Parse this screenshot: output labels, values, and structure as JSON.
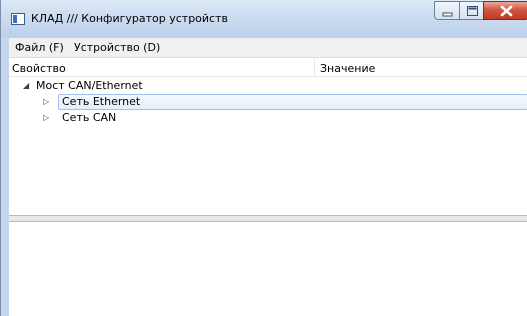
{
  "window": {
    "title": "КЛАД /// Конфигуратор устройств",
    "controls": [
      "minimize-icon",
      "maximize-icon",
      "close-icon"
    ]
  },
  "menu": {
    "items": [
      {
        "label": "Файл (F)"
      },
      {
        "label": "Устройство (D)"
      }
    ]
  },
  "table": {
    "columns": [
      "Свойство",
      "Значение"
    ]
  },
  "tree": {
    "root": {
      "label": "Мост CAN/Ethernet",
      "expanded": true
    },
    "children": [
      {
        "label": "Сеть Ethernet",
        "expanded": false,
        "selected": true
      },
      {
        "label": "Сеть CAN",
        "expanded": false,
        "selected": false
      }
    ]
  },
  "colors": {
    "selection_border": "#9fc3ea",
    "titlebar": "#c9dbf0",
    "close_button": "#c03a24"
  }
}
